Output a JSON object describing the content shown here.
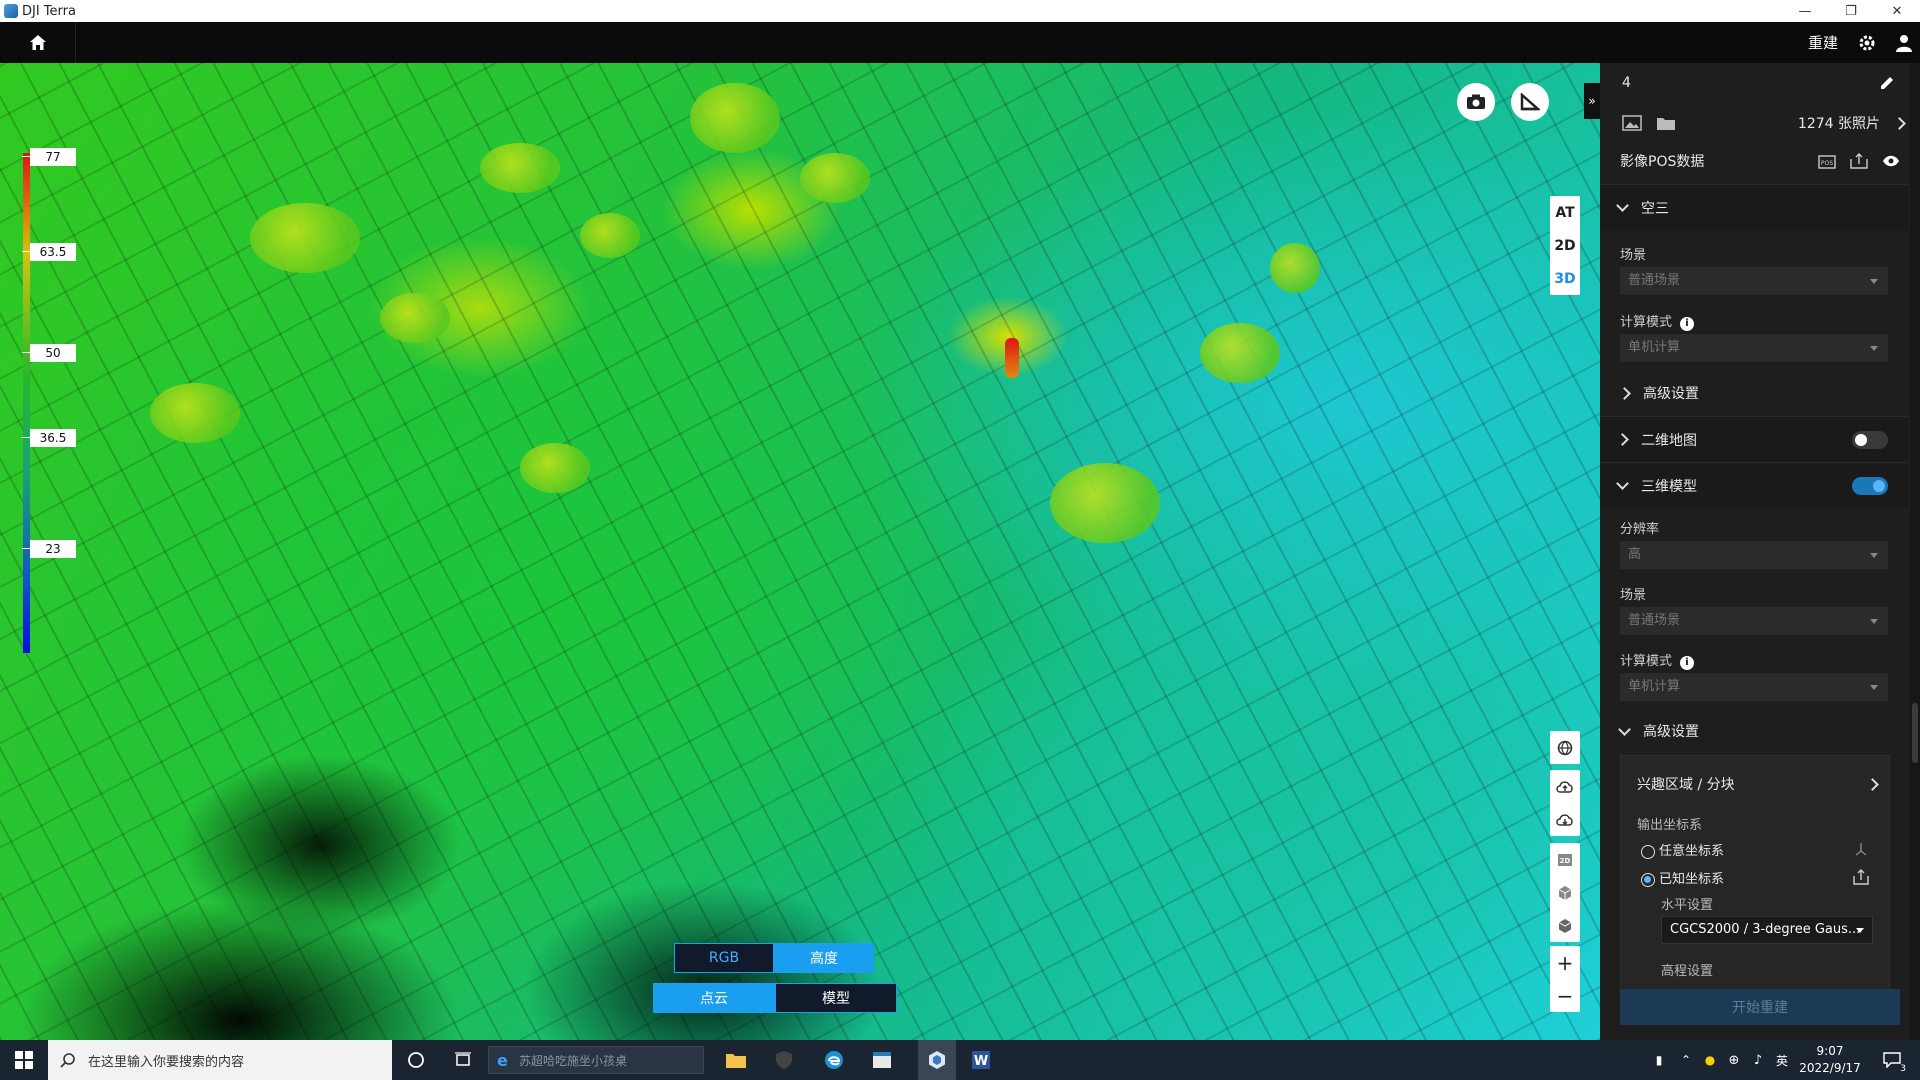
{
  "window": {
    "title": "DJI Terra"
  },
  "header": {
    "rebuild_label": "重建"
  },
  "legend": {
    "values": [
      "77",
      "63.5",
      "50",
      "36.5",
      "23"
    ]
  },
  "view_modes": [
    "AT",
    "2D",
    "3D"
  ],
  "view_active": "3D",
  "color_mode": {
    "options": [
      "RGB",
      "高度"
    ],
    "active": "高度"
  },
  "display_mode": {
    "options": [
      "点云",
      "模型"
    ],
    "active": "点云"
  },
  "panel": {
    "mission_name": "4",
    "photo_count": "1274 张照片",
    "pos_label": "影像POS数据",
    "aerotriangulation": {
      "title": "空三",
      "scene_label": "场景",
      "scene_value": "普通场景",
      "compute_label": "计算模式",
      "compute_value": "单机计算",
      "advanced_label": "高级设置"
    },
    "map2d": {
      "title": "二维地图",
      "enabled": false
    },
    "model3d": {
      "title": "三维模型",
      "enabled": true,
      "resolution_label": "分辨率",
      "resolution_value": "高",
      "scene_label": "场景",
      "scene_value": "普通场景",
      "compute_label": "计算模式",
      "compute_value": "单机计算",
      "advanced_label": "高级设置",
      "roi_label": "兴趣区域 / 分块",
      "output_crs_label": "输出坐标系",
      "crs_any": "任意坐标系",
      "crs_known": "已知坐标系",
      "horizontal_label": "水平设置",
      "horizontal_value": "CGCS2000 / 3-degree Gaus...",
      "elevation_label": "高程设置"
    },
    "start_label": "开始重建"
  },
  "taskbar": {
    "search_placeholder": "在这里输入你要搜索的内容",
    "address_text": "苏超哈吃施坐小孩桌",
    "ime": "英",
    "time": "9:07",
    "date": "2022/9/17",
    "notification_count": "3"
  }
}
